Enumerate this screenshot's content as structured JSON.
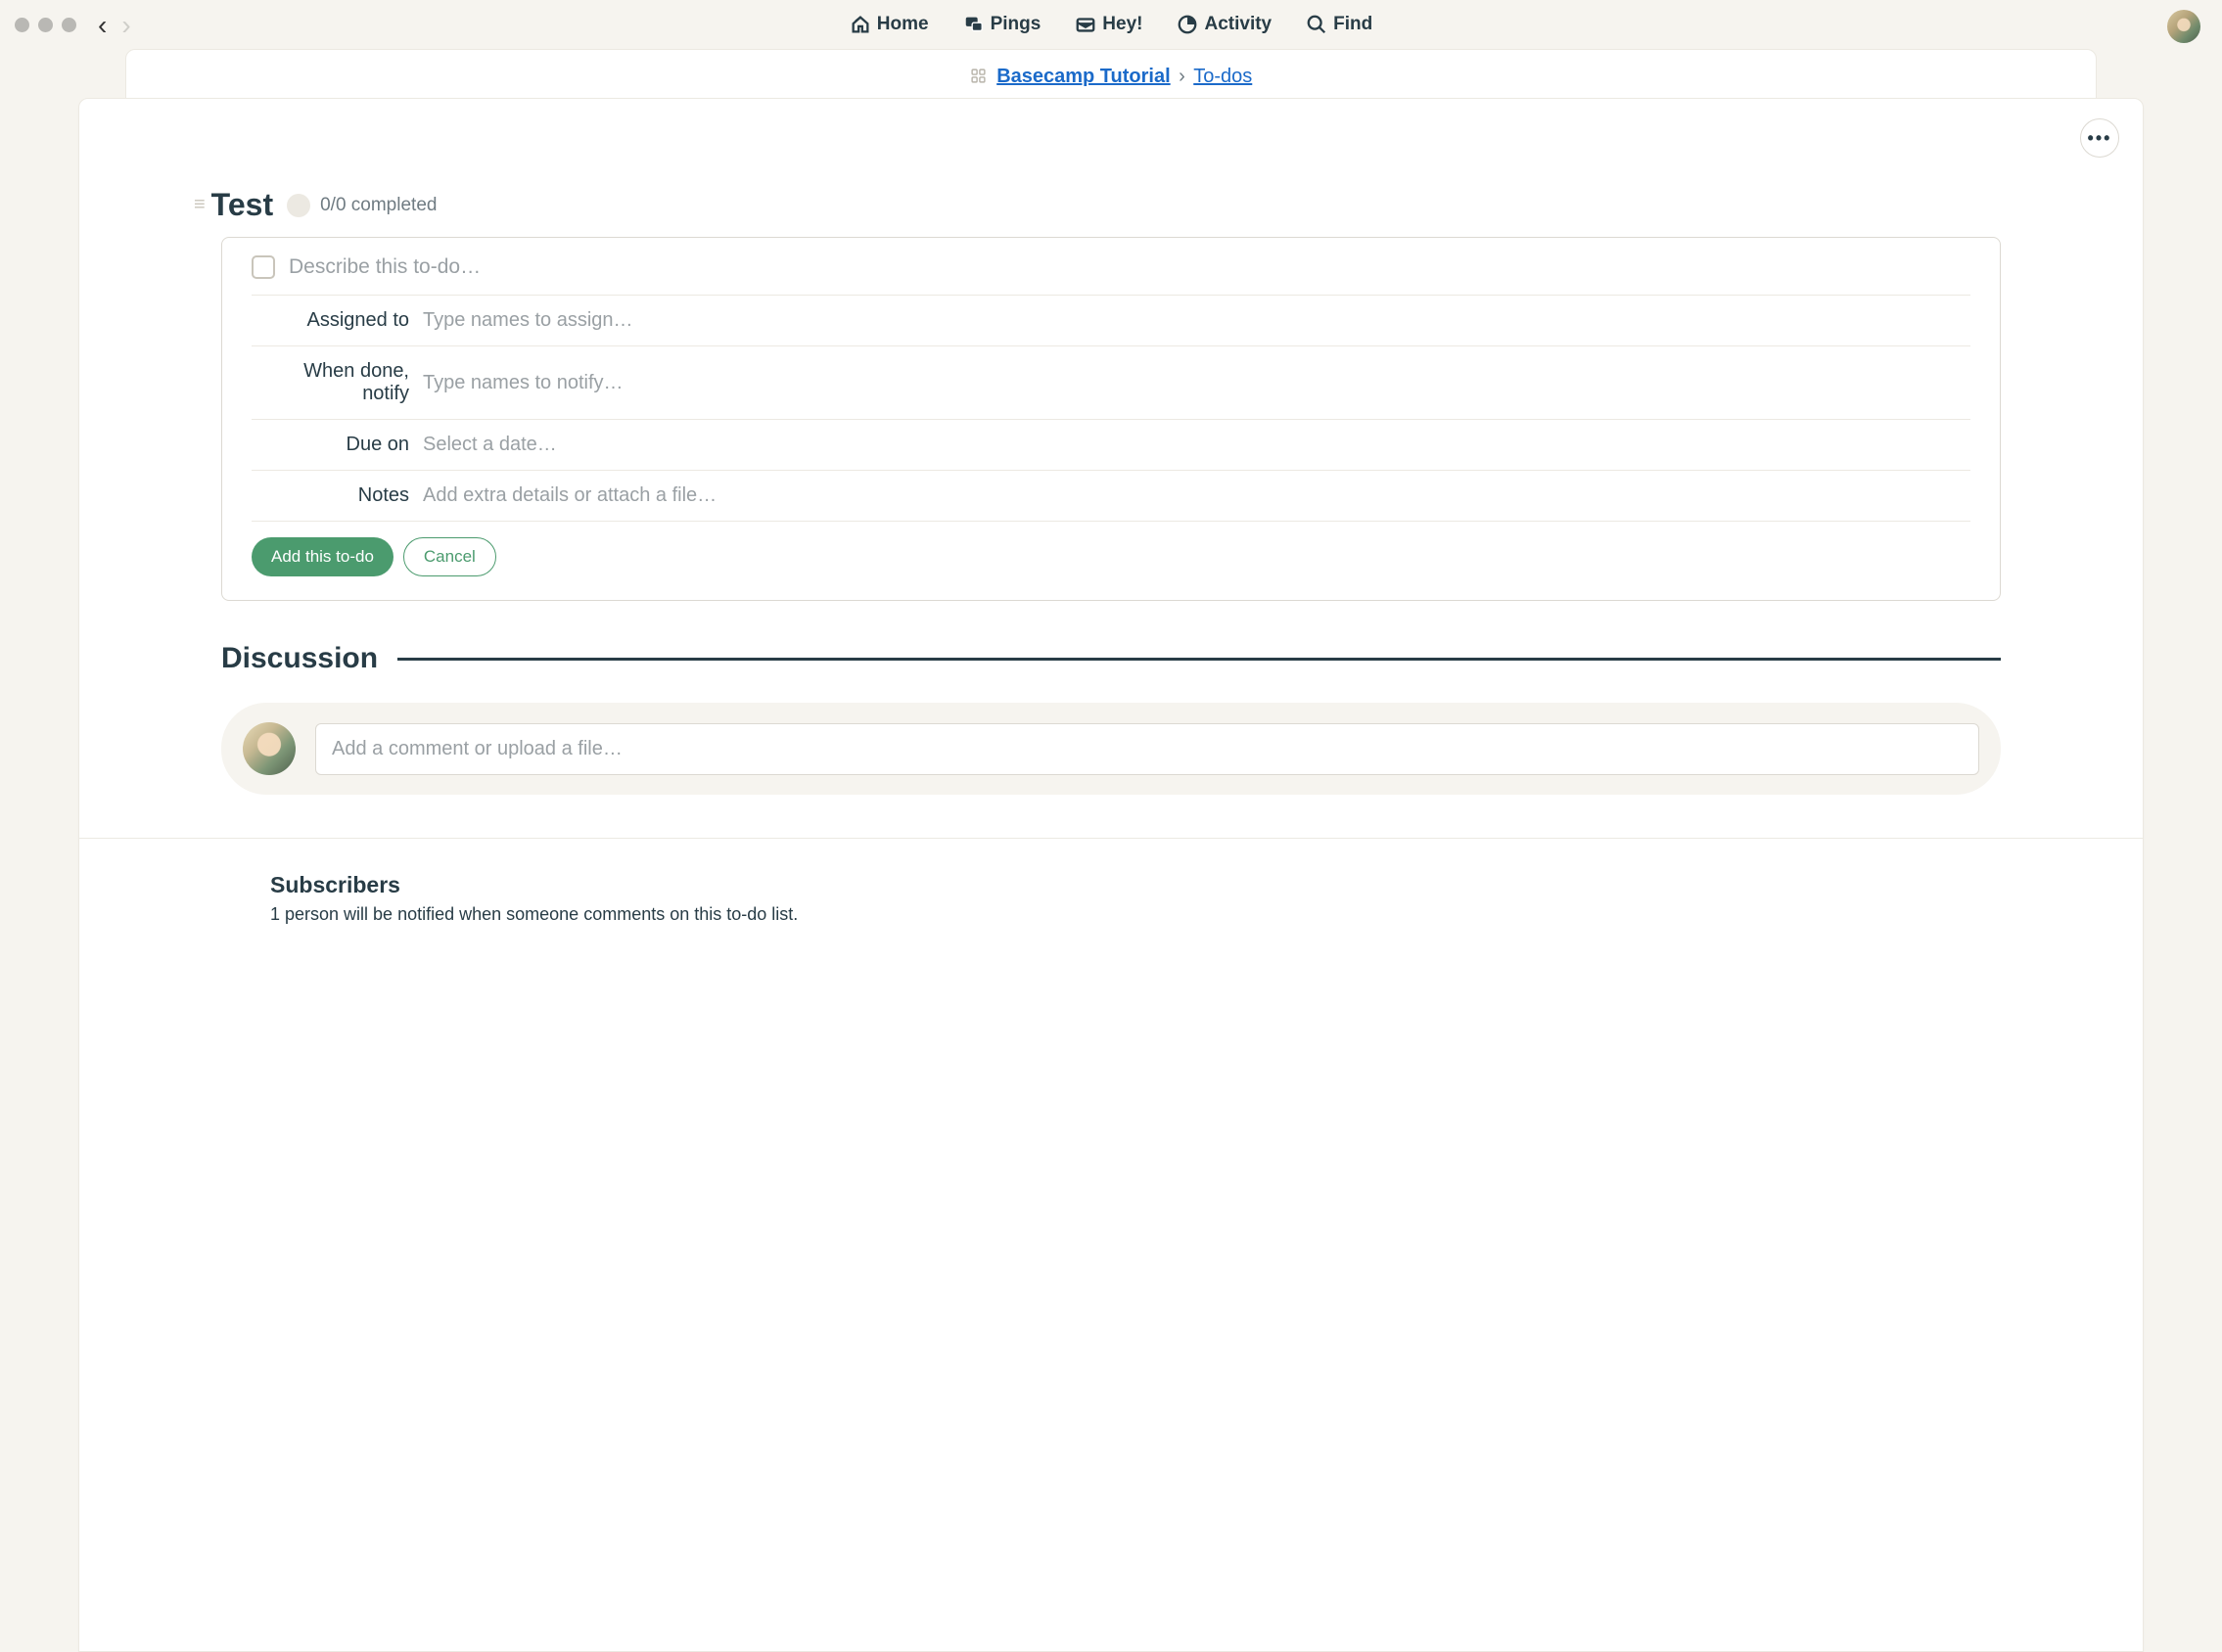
{
  "nav": {
    "home": "Home",
    "pings": "Pings",
    "hey": "Hey!",
    "activity": "Activity",
    "find": "Find"
  },
  "breadcrumb": {
    "project": "Basecamp Tutorial",
    "section": "To-dos"
  },
  "more_label": "•••",
  "list": {
    "title": "Test",
    "progress": "0/0 completed"
  },
  "form": {
    "desc_placeholder": "Describe this to-do…",
    "rows": {
      "assigned": {
        "label": "Assigned to",
        "placeholder": "Type names to assign…"
      },
      "notify": {
        "label": "When done, notify",
        "placeholder": "Type names to notify…"
      },
      "due": {
        "label": "Due on",
        "placeholder": "Select a date…"
      },
      "notes": {
        "label": "Notes",
        "placeholder": "Add extra details or attach a file…"
      }
    },
    "submit": "Add this to-do",
    "cancel": "Cancel"
  },
  "discussion": {
    "title": "Discussion",
    "comment_placeholder": "Add a comment or upload a file…"
  },
  "subscribers": {
    "title": "Subscribers",
    "text": "1 person will be notified when someone comments on this to-do list."
  }
}
